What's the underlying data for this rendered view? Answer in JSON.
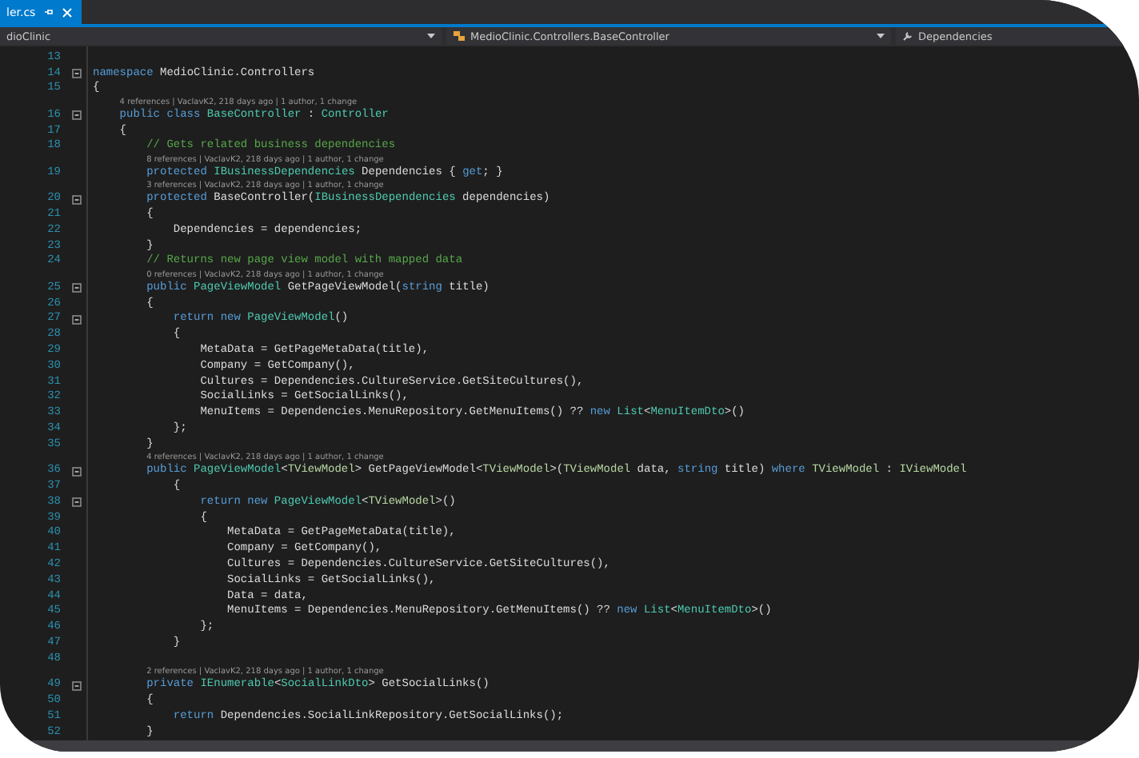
{
  "tab": {
    "title": "ler.cs"
  },
  "navigation": [
    {
      "kind": "project",
      "label": "dioClinic"
    },
    {
      "kind": "class",
      "label": "MedioClinic.Controllers.BaseController"
    },
    {
      "kind": "member",
      "label": "Dependencies"
    }
  ],
  "lines": [
    {
      "number": "13",
      "foldable": false
    },
    {
      "number": "14",
      "foldable": true,
      "tokens": [
        {
          "kind": "keyword",
          "text": "namespace"
        },
        {
          "kind": "plain",
          "text": " MedioClinic.Controllers"
        }
      ]
    },
    {
      "number": "15",
      "foldable": false,
      "tokens": [
        {
          "kind": "plain",
          "text": "{"
        }
      ]
    },
    {
      "number": "16",
      "foldable": true,
      "codelens": "4 references | VaclavK2, 218 days ago | 1 author, 1 change",
      "tokens": [
        {
          "kind": "keyword",
          "text": "    public class "
        },
        {
          "kind": "type",
          "text": "BaseController"
        },
        {
          "kind": "plain",
          "text": " : "
        },
        {
          "kind": "type",
          "text": "Controller"
        }
      ]
    },
    {
      "number": "17",
      "foldable": false,
      "tokens": [
        {
          "kind": "plain",
          "text": "    {"
        }
      ]
    },
    {
      "number": "18",
      "foldable": false,
      "tokens": [
        {
          "kind": "comment",
          "text": "        // Gets related business dependencies"
        }
      ]
    },
    {
      "number": "19",
      "foldable": false,
      "codelens": "8 references | VaclavK2, 218 days ago | 1 author, 1 change",
      "tokens": [
        {
          "kind": "keyword",
          "text": "        protected "
        },
        {
          "kind": "type",
          "text": "IBusinessDependencies"
        },
        {
          "kind": "plain",
          "text": " Dependencies { "
        },
        {
          "kind": "keyword",
          "text": "get"
        },
        {
          "kind": "plain",
          "text": "; }"
        }
      ]
    },
    {
      "number": "20",
      "foldable": true,
      "codelens": "3 references | VaclavK2, 218 days ago | 1 author, 1 change",
      "tokens": [
        {
          "kind": "keyword",
          "text": "        protected "
        },
        {
          "kind": "plain",
          "text": "BaseController("
        },
        {
          "kind": "type",
          "text": "IBusinessDependencies"
        },
        {
          "kind": "plain",
          "text": " dependencies)"
        }
      ]
    },
    {
      "number": "21",
      "foldable": false,
      "tokens": [
        {
          "kind": "plain",
          "text": "        {"
        }
      ]
    },
    {
      "number": "22",
      "foldable": false,
      "tokens": [
        {
          "kind": "plain",
          "text": "            Dependencies = dependencies;"
        }
      ]
    },
    {
      "number": "23",
      "foldable": false,
      "tokens": [
        {
          "kind": "plain",
          "text": "        }"
        }
      ]
    },
    {
      "number": "24",
      "foldable": false,
      "tokens": [
        {
          "kind": "comment",
          "text": "        // Returns new page view model with mapped data"
        }
      ]
    },
    {
      "number": "25",
      "foldable": true,
      "codelens": "0 references | VaclavK2, 218 days ago | 1 author, 1 change",
      "tokens": [
        {
          "kind": "keyword",
          "text": "        public "
        },
        {
          "kind": "type",
          "text": "PageViewModel"
        },
        {
          "kind": "plain",
          "text": " GetPageViewModel("
        },
        {
          "kind": "keyword",
          "text": "string"
        },
        {
          "kind": "plain",
          "text": " title)"
        }
      ]
    },
    {
      "number": "26",
      "foldable": false,
      "tokens": [
        {
          "kind": "plain",
          "text": "        {"
        }
      ]
    },
    {
      "number": "27",
      "foldable": true,
      "tokens": [
        {
          "kind": "keyword",
          "text": "            return new "
        },
        {
          "kind": "type",
          "text": "PageViewModel"
        },
        {
          "kind": "plain",
          "text": "()"
        }
      ]
    },
    {
      "number": "28",
      "foldable": false,
      "tokens": [
        {
          "kind": "plain",
          "text": "            {"
        }
      ]
    },
    {
      "number": "29",
      "foldable": false,
      "tokens": [
        {
          "kind": "plain",
          "text": "                MetaData = GetPageMetaData(title),"
        }
      ]
    },
    {
      "number": "30",
      "foldable": false,
      "tokens": [
        {
          "kind": "plain",
          "text": "                Company = GetCompany(),"
        }
      ]
    },
    {
      "number": "31",
      "foldable": false,
      "tokens": [
        {
          "kind": "plain",
          "text": "                Cultures = Dependencies.CultureService.GetSiteCultures(),"
        }
      ]
    },
    {
      "number": "32",
      "foldable": false,
      "tokens": [
        {
          "kind": "plain",
          "text": "                SocialLinks = GetSocialLinks(),"
        }
      ]
    },
    {
      "number": "33",
      "foldable": false,
      "tokens": [
        {
          "kind": "plain",
          "text": "                MenuItems = Dependencies.MenuRepository.GetMenuItems() ?? "
        },
        {
          "kind": "keyword",
          "text": "new "
        },
        {
          "kind": "type",
          "text": "List"
        },
        {
          "kind": "plain",
          "text": "<"
        },
        {
          "kind": "type",
          "text": "MenuItemDto"
        },
        {
          "kind": "plain",
          "text": ">()"
        }
      ]
    },
    {
      "number": "34",
      "foldable": false,
      "tokens": [
        {
          "kind": "plain",
          "text": "            };"
        }
      ]
    },
    {
      "number": "35",
      "foldable": false,
      "tokens": [
        {
          "kind": "plain",
          "text": "        }"
        }
      ]
    },
    {
      "number": "36",
      "foldable": true,
      "codelens": "4 references | VaclavK2, 218 days ago | 1 author, 1 change",
      "tokens": [
        {
          "kind": "keyword",
          "text": "        public "
        },
        {
          "kind": "type",
          "text": "PageViewModel"
        },
        {
          "kind": "plain",
          "text": "<"
        },
        {
          "kind": "typeparam",
          "text": "TViewModel"
        },
        {
          "kind": "plain",
          "text": "> GetPageViewModel<"
        },
        {
          "kind": "typeparam",
          "text": "TViewModel"
        },
        {
          "kind": "plain",
          "text": ">("
        },
        {
          "kind": "typeparam",
          "text": "TViewModel"
        },
        {
          "kind": "plain",
          "text": " data, "
        },
        {
          "kind": "keyword",
          "text": "string"
        },
        {
          "kind": "plain",
          "text": " title) "
        },
        {
          "kind": "keyword",
          "text": "where "
        },
        {
          "kind": "typeparam",
          "text": "TViewModel"
        },
        {
          "kind": "plain",
          "text": " : "
        },
        {
          "kind": "typeparam",
          "text": "IViewModel"
        }
      ]
    },
    {
      "number": "37",
      "foldable": false,
      "tokens": [
        {
          "kind": "plain",
          "text": "            {"
        }
      ]
    },
    {
      "number": "38",
      "foldable": true,
      "tokens": [
        {
          "kind": "keyword",
          "text": "                return new "
        },
        {
          "kind": "type",
          "text": "PageViewModel"
        },
        {
          "kind": "plain",
          "text": "<"
        },
        {
          "kind": "typeparam",
          "text": "TViewModel"
        },
        {
          "kind": "plain",
          "text": ">()"
        }
      ]
    },
    {
      "number": "39",
      "foldable": false,
      "tokens": [
        {
          "kind": "plain",
          "text": "                {"
        }
      ]
    },
    {
      "number": "40",
      "foldable": false,
      "tokens": [
        {
          "kind": "plain",
          "text": "                    MetaData = GetPageMetaData(title),"
        }
      ]
    },
    {
      "number": "41",
      "foldable": false,
      "tokens": [
        {
          "kind": "plain",
          "text": "                    Company = GetCompany(),"
        }
      ]
    },
    {
      "number": "42",
      "foldable": false,
      "tokens": [
        {
          "kind": "plain",
          "text": "                    Cultures = Dependencies.CultureService.GetSiteCultures(),"
        }
      ]
    },
    {
      "number": "43",
      "foldable": false,
      "tokens": [
        {
          "kind": "plain",
          "text": "                    SocialLinks = GetSocialLinks(),"
        }
      ]
    },
    {
      "number": "44",
      "foldable": false,
      "tokens": [
        {
          "kind": "plain",
          "text": "                    Data = data,"
        }
      ]
    },
    {
      "number": "45",
      "foldable": false,
      "tokens": [
        {
          "kind": "plain",
          "text": "                    MenuItems = Dependencies.MenuRepository.GetMenuItems() ?? "
        },
        {
          "kind": "keyword",
          "text": "new "
        },
        {
          "kind": "type",
          "text": "List"
        },
        {
          "kind": "plain",
          "text": "<"
        },
        {
          "kind": "type",
          "text": "MenuItemDto"
        },
        {
          "kind": "plain",
          "text": ">()"
        }
      ]
    },
    {
      "number": "46",
      "foldable": false,
      "tokens": [
        {
          "kind": "plain",
          "text": "                };"
        }
      ]
    },
    {
      "number": "47",
      "foldable": false,
      "tokens": [
        {
          "kind": "plain",
          "text": "            }"
        }
      ]
    },
    {
      "number": "48",
      "foldable": false
    },
    {
      "number": "49",
      "foldable": true,
      "codelens": "2 references | VaclavK2, 218 days ago | 1 author, 1 change",
      "tokens": [
        {
          "kind": "keyword",
          "text": "        private "
        },
        {
          "kind": "type",
          "text": "IEnumerable"
        },
        {
          "kind": "plain",
          "text": "<"
        },
        {
          "kind": "type",
          "text": "SocialLinkDto"
        },
        {
          "kind": "plain",
          "text": "> GetSocialLinks()"
        }
      ]
    },
    {
      "number": "50",
      "foldable": false,
      "tokens": [
        {
          "kind": "plain",
          "text": "        {"
        }
      ]
    },
    {
      "number": "51",
      "foldable": false,
      "tokens": [
        {
          "kind": "keyword",
          "text": "            return "
        },
        {
          "kind": "plain",
          "text": "Dependencies.SocialLinkRepository.GetSocialLinks();"
        }
      ]
    },
    {
      "number": "52",
      "foldable": false,
      "tokens": [
        {
          "kind": "plain",
          "text": "        }"
        }
      ]
    }
  ]
}
